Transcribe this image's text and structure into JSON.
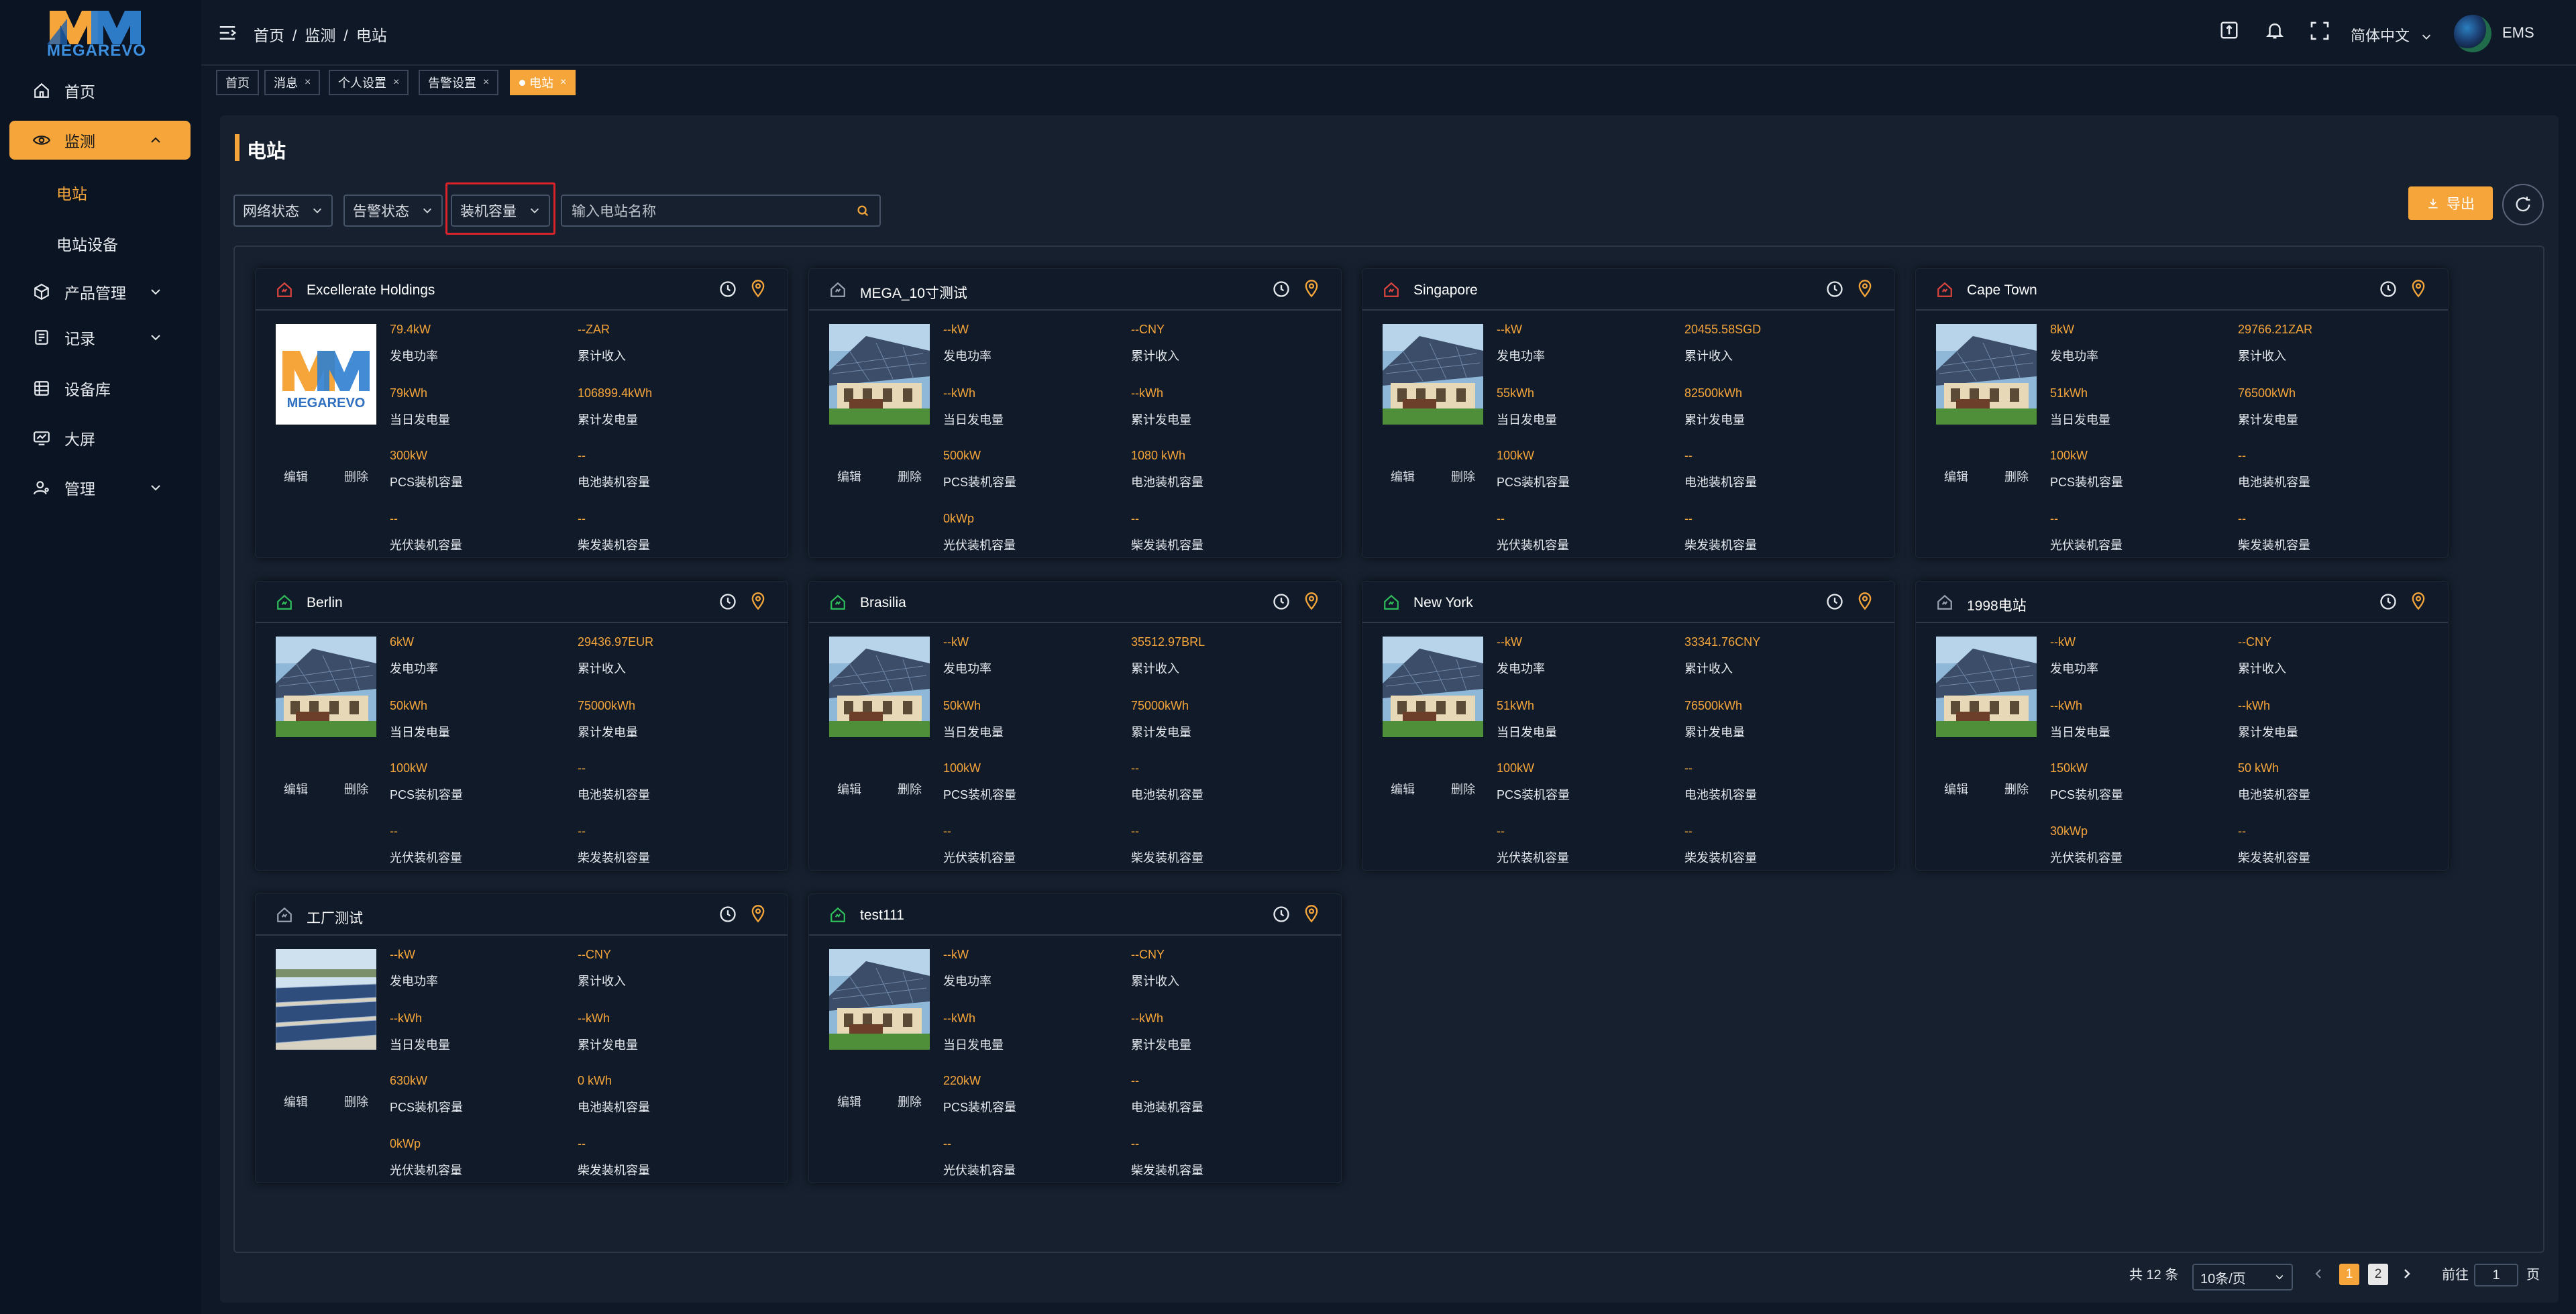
{
  "brand": {
    "logo_text": "MEGAREVO"
  },
  "sidebar": {
    "items": [
      {
        "label": "首页",
        "icon": "home-icon"
      },
      {
        "label": "监测",
        "icon": "eye-icon"
      },
      {
        "label": "产品管理",
        "icon": "cube-icon"
      },
      {
        "label": "记录",
        "icon": "record-icon"
      },
      {
        "label": "设备库",
        "icon": "list-icon"
      },
      {
        "label": "大屏",
        "icon": "screen-icon"
      },
      {
        "label": "管理",
        "icon": "user-manage-icon"
      }
    ],
    "sub_items": [
      {
        "label": "电站"
      },
      {
        "label": "电站设备"
      }
    ]
  },
  "header": {
    "breadcrumb": [
      "首页",
      "监测",
      "电站"
    ],
    "language": "简体中文",
    "user": "EMS"
  },
  "tags": [
    {
      "label": "首页"
    },
    {
      "label": "消息"
    },
    {
      "label": "个人设置"
    },
    {
      "label": "告警设置"
    },
    {
      "label": "电站"
    }
  ],
  "page": {
    "title": "电站",
    "filters": [
      "网络状态",
      "告警状态",
      "装机容量"
    ],
    "search_placeholder": "输入电站名称",
    "export_label": "导出"
  },
  "card_labels": {
    "edit": "编辑",
    "delete": "删除",
    "power": "发电功率",
    "income": "累计收入",
    "day_energy": "当日发电量",
    "total_energy": "累计发电量",
    "pcs": "PCS装机容量",
    "battery": "电池装机容量",
    "pv": "光伏装机容量",
    "diesel": "柴发装机容量"
  },
  "stations": [
    {
      "name": "Excellerate Holdings",
      "status_color": "#e0463e",
      "thumb": "logo",
      "power": "79.4kW",
      "income": "--ZAR",
      "day_energy": "79kWh",
      "total_energy": "106899.4kWh",
      "pcs": "300kW",
      "battery": "--",
      "pv": "--",
      "diesel": "--"
    },
    {
      "name": "MEGA_10寸测试",
      "status_color": "#9aa3af",
      "thumb": "house",
      "power": "--kW",
      "income": "--CNY",
      "day_energy": "--kWh",
      "total_energy": "--kWh",
      "pcs": "500kW",
      "battery": "1080 kWh",
      "pv": "0kWp",
      "diesel": "--"
    },
    {
      "name": "Singapore",
      "status_color": "#e0463e",
      "thumb": "house",
      "power": "--kW",
      "income": "20455.58SGD",
      "day_energy": "55kWh",
      "total_energy": "82500kWh",
      "pcs": "100kW",
      "battery": "--",
      "pv": "--",
      "diesel": "--"
    },
    {
      "name": "Cape Town",
      "status_color": "#e0463e",
      "thumb": "house",
      "power": "8kW",
      "income": "29766.21ZAR",
      "day_energy": "51kWh",
      "total_energy": "76500kWh",
      "pcs": "100kW",
      "battery": "--",
      "pv": "--",
      "diesel": "--"
    },
    {
      "name": "Berlin",
      "status_color": "#2fbf5b",
      "thumb": "house",
      "power": "6kW",
      "income": "29436.97EUR",
      "day_energy": "50kWh",
      "total_energy": "75000kWh",
      "pcs": "100kW",
      "battery": "--",
      "pv": "--",
      "diesel": "--"
    },
    {
      "name": "Brasilia",
      "status_color": "#2fbf5b",
      "thumb": "house",
      "power": "--kW",
      "income": "35512.97BRL",
      "day_energy": "50kWh",
      "total_energy": "75000kWh",
      "pcs": "100kW",
      "battery": "--",
      "pv": "--",
      "diesel": "--"
    },
    {
      "name": "New York",
      "status_color": "#2fbf5b",
      "thumb": "house",
      "power": "--kW",
      "income": "33341.76CNY",
      "day_energy": "51kWh",
      "total_energy": "76500kWh",
      "pcs": "100kW",
      "battery": "--",
      "pv": "--",
      "diesel": "--"
    },
    {
      "name": "1998电站",
      "status_color": "#9aa3af",
      "thumb": "house",
      "power": "--kW",
      "income": "--CNY",
      "day_energy": "--kWh",
      "total_energy": "--kWh",
      "pcs": "150kW",
      "battery": "50 kWh",
      "pv": "30kWp",
      "diesel": "--"
    },
    {
      "name": "工厂测试",
      "status_color": "#9aa3af",
      "thumb": "field",
      "power": "--kW",
      "income": "--CNY",
      "day_energy": "--kWh",
      "total_energy": "--kWh",
      "pcs": "630kW",
      "battery": "0 kWh",
      "pv": "0kWp",
      "diesel": "--"
    },
    {
      "name": "test111",
      "status_color": "#2fbf5b",
      "thumb": "house",
      "power": "--kW",
      "income": "--CNY",
      "day_energy": "--kWh",
      "total_energy": "--kWh",
      "pcs": "220kW",
      "battery": "--",
      "pv": "--",
      "diesel": "--"
    }
  ],
  "pagination": {
    "total": "共 12 条",
    "page_size": "10条/页",
    "pages": [
      "1",
      "2"
    ],
    "goto_label": "前往",
    "goto_value": "1",
    "page_suffix": "页"
  },
  "colors": {
    "accent": "#f5a53a",
    "background": "#0e1827",
    "highlight_border": "#d9222a"
  }
}
